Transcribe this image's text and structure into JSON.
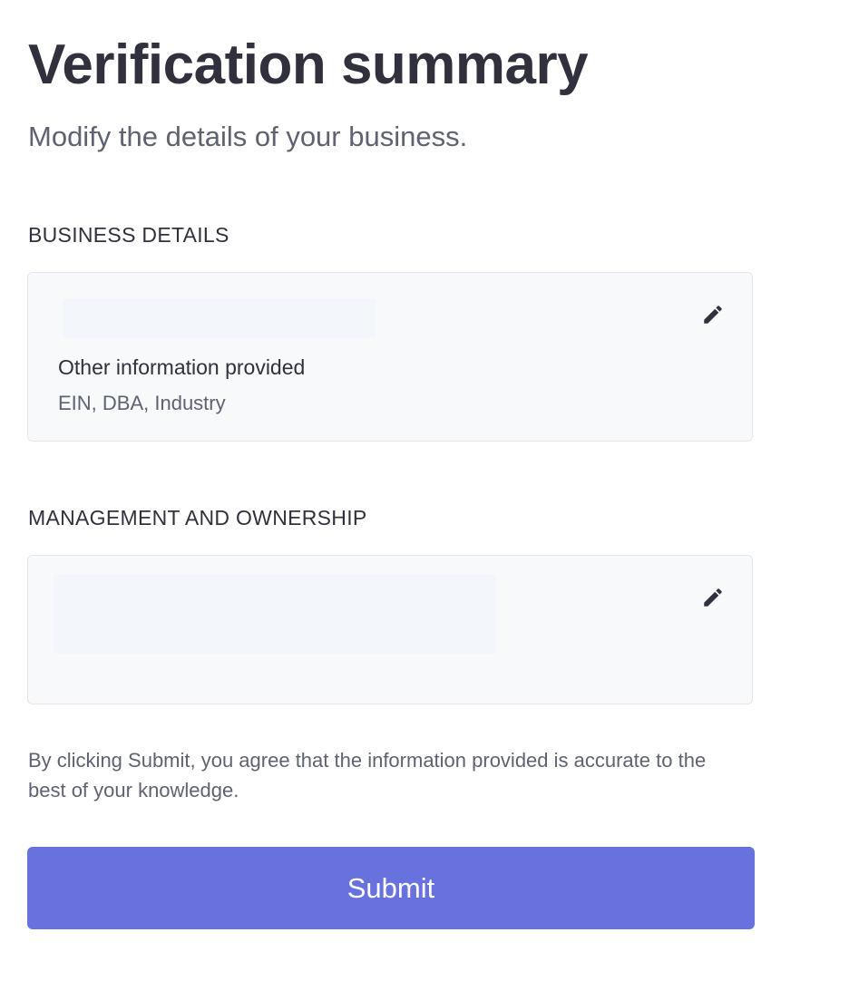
{
  "header": {
    "title": "Verification summary",
    "subtitle": "Modify the details of your business."
  },
  "business_details": {
    "heading": "BUSINESS DETAILS",
    "info_label": "Other information provided",
    "info_value": "EIN, DBA, Industry",
    "edit_icon": "pencil-icon"
  },
  "management": {
    "heading": "MANAGEMENT AND OWNERSHIP",
    "edit_icon": "pencil-icon"
  },
  "agreement": {
    "text": "By clicking Submit, you agree that the information provided is accurate to the best of your knowledge."
  },
  "actions": {
    "submit_label": "Submit"
  },
  "colors": {
    "accent": "#6872de",
    "text_primary": "#30313d",
    "text_secondary": "#5f6270",
    "card_background": "#f7f9fb",
    "card_border": "#e3e6ec"
  }
}
